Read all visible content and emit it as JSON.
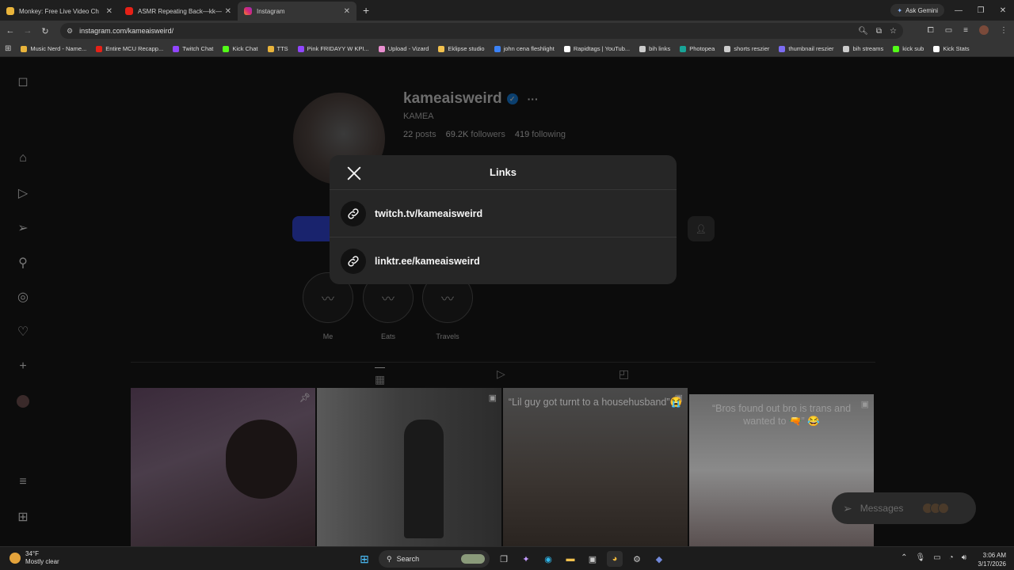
{
  "browser": {
    "tabs": [
      {
        "label": "Monkey: Free Live Video Ch",
        "color": "#e9b43b",
        "active": false
      },
      {
        "label": "ASMR Repeating Back—kk—ki",
        "color": "#e62117",
        "active": false
      },
      {
        "label": "Instagram",
        "color": "#d62976",
        "active": true
      }
    ],
    "new_tab": "+",
    "gemini": "Ask Gemini",
    "url": "instagram.com/kameaisweird/",
    "bookmarks": [
      {
        "label": "Music Nerd - Name...",
        "color": "#e9b43b"
      },
      {
        "label": "Entire MCU Recapp...",
        "color": "#e62117"
      },
      {
        "label": "Twitch Chat",
        "color": "#9146ff"
      },
      {
        "label": "Kick Chat",
        "color": "#53fc18"
      },
      {
        "label": "TTS",
        "color": "#e9b43b"
      },
      {
        "label": "Pink FRIDAYY W KPI...",
        "color": "#9146ff"
      },
      {
        "label": "Upload - Vizard",
        "color": "#e98ed0"
      },
      {
        "label": "Eklipse studio",
        "color": "#f2c14e"
      },
      {
        "label": "john cena fleshlight",
        "color": "#3b82f6"
      },
      {
        "label": "Rapidtags | YouTub...",
        "color": "#ffffff"
      },
      {
        "label": "bih links",
        "color": "#cccccc"
      },
      {
        "label": "Photopea",
        "color": "#18a497"
      },
      {
        "label": "shorts reszier",
        "color": "#cccccc"
      },
      {
        "label": "thumbnail reszier",
        "color": "#7c6cf2"
      },
      {
        "label": "bih streams",
        "color": "#cccccc"
      },
      {
        "label": "kick sub",
        "color": "#53fc18"
      },
      {
        "label": "Kick Stats",
        "color": "#ffffff"
      }
    ]
  },
  "profile": {
    "username": "kameaisweird",
    "full_name": "KAMEA",
    "posts_count": "22",
    "posts_label": "posts",
    "followers_count": "69.2K",
    "followers_label": "followers",
    "following_count": "419",
    "following_label": "following",
    "highlights": [
      {
        "label": "Me"
      },
      {
        "label": "Eats"
      },
      {
        "label": "Travels"
      }
    ]
  },
  "posts": [
    {
      "caption": "",
      "pinned": true
    },
    {
      "caption": "",
      "pinned": false
    },
    {
      "caption": "“Lil guy got turnt to a househusband”😭",
      "pinned": false
    },
    {
      "caption": "“Bros found out bro is trans and wanted to 🔫” 😂",
      "pinned": false
    }
  ],
  "messages_label": "Messages",
  "modal": {
    "title": "Links",
    "links": [
      {
        "label": "twitch.tv/kameaisweird"
      },
      {
        "label": "linktr.ee/kameaisweird"
      }
    ]
  },
  "taskbar": {
    "temp": "34°F",
    "weather": "Mostly clear",
    "search": "Search",
    "time": "3:06 AM",
    "date": "3/17/2026"
  }
}
